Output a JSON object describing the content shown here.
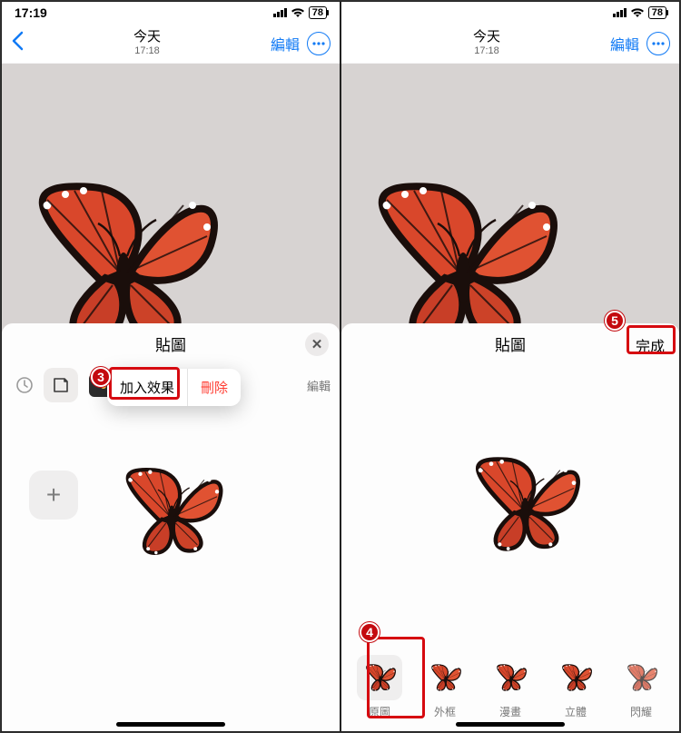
{
  "status": {
    "time": "17:19",
    "battery": "78"
  },
  "nav": {
    "title": "今天",
    "subtitle": "17:18",
    "edit": "編輯"
  },
  "sheet": {
    "title": "貼圖",
    "done": "完成",
    "toolbar_edit": "編輯",
    "add_effect": "加入效果",
    "delete": "刪除"
  },
  "effects": {
    "items": [
      {
        "label": "原圖"
      },
      {
        "label": "外框"
      },
      {
        "label": "漫畫"
      },
      {
        "label": "立體"
      },
      {
        "label": "閃耀"
      }
    ]
  },
  "badges": {
    "b3": "3",
    "b4": "4",
    "b5": "5"
  }
}
